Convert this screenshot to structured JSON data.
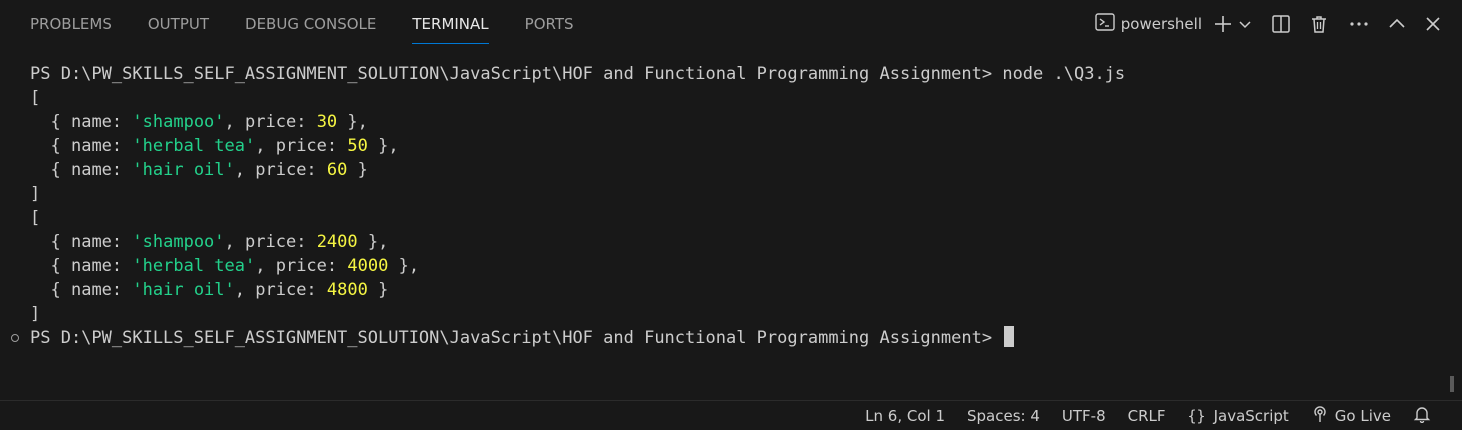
{
  "panel": {
    "tabs": [
      {
        "label": "PROBLEMS",
        "active": false
      },
      {
        "label": "OUTPUT",
        "active": false
      },
      {
        "label": "DEBUG CONSOLE",
        "active": false
      },
      {
        "label": "TERMINAL",
        "active": true
      },
      {
        "label": "PORTS",
        "active": false
      }
    ],
    "terminal_name": "powershell",
    "accent_color": "#0078d4"
  },
  "terminal": {
    "prompt": "PS D:\\PW_SKILLS_SELF_ASSIGNMENT_SOLUTION\\JavaScript\\HOF and Functional Programming Assignment>",
    "command": "node .\\Q3.js",
    "string_color": "#23d18b",
    "number_color": "#f5f543",
    "open_bracket": "[",
    "close_bracket": "]",
    "outputs": [
      [
        {
          "name": "'shampoo'",
          "price": "30",
          "sep": ","
        },
        {
          "name": "'herbal tea'",
          "price": "50",
          "sep": ","
        },
        {
          "name": "'hair oil'",
          "price": "60",
          "sep": ""
        }
      ],
      [
        {
          "name": "'shampoo'",
          "price": "2400",
          "sep": ","
        },
        {
          "name": "'herbal tea'",
          "price": "4000",
          "sep": ","
        },
        {
          "name": "'hair oil'",
          "price": "4800",
          "sep": ""
        }
      ]
    ],
    "kw_name": "name:",
    "kw_price": "price:",
    "open_brace": "{ ",
    "close_brace": " }"
  },
  "statusbar": {
    "position": "Ln 6, Col 1",
    "spaces": "Spaces: 4",
    "encoding": "UTF-8",
    "eol": "CRLF",
    "lang_icon": "{}",
    "language": "JavaScript",
    "go_live": "Go Live"
  }
}
